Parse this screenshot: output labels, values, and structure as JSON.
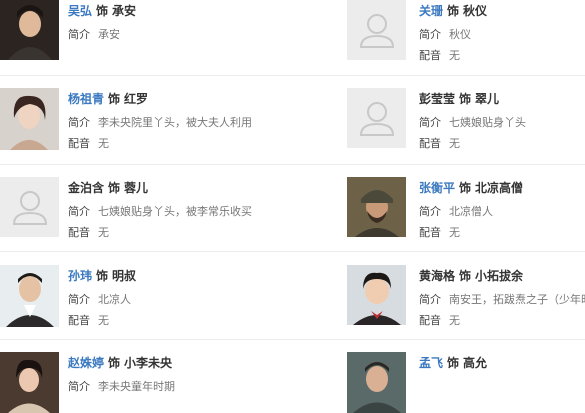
{
  "rows": [
    {
      "left": {
        "actor": "吴弘",
        "as": "饰",
        "role": "承安",
        "intro_label": "简介",
        "intro": "承安",
        "dub_label": "",
        "dub": ""
      },
      "right": {
        "actor": "关珊",
        "as": "饰",
        "role": "秋仪",
        "intro_label": "简介",
        "intro": "秋仪",
        "dub_label": "配音",
        "dub": "无"
      }
    },
    {
      "left": {
        "actor": "杨祖青",
        "as": "饰",
        "role": "红罗",
        "intro_label": "简介",
        "intro": "李未央院里丫头，被大夫人利用",
        "dub_label": "配音",
        "dub": "无"
      },
      "right": {
        "actor": "彭莹莹",
        "as": "饰",
        "role": "翠儿",
        "intro_label": "简介",
        "intro": "七姨娘贴身丫头",
        "dub_label": "配音",
        "dub": "无"
      }
    },
    {
      "left": {
        "actor": "金泊含",
        "as": "饰",
        "role": "蓉儿",
        "intro_label": "简介",
        "intro": "七姨娘贴身丫头，被李常乐收买",
        "dub_label": "配音",
        "dub": "无"
      },
      "right": {
        "actor": "张衡平",
        "as": "饰",
        "role": "北凉高僧",
        "intro_label": "简介",
        "intro": "北凉僧人",
        "dub_label": "配音",
        "dub": "无"
      }
    },
    {
      "left": {
        "actor": "孙玮",
        "as": "饰",
        "role": "明叔",
        "intro_label": "简介",
        "intro": "北凉人",
        "dub_label": "配音",
        "dub": "无"
      },
      "right": {
        "actor": "黄海格",
        "as": "饰",
        "role": "小拓拔余",
        "intro_label": "简介",
        "intro": "南安王，拓跋焘之子（少年时）",
        "dub_label": "配音",
        "dub": "无"
      }
    },
    {
      "left": {
        "actor": "赵姝婷",
        "as": "饰",
        "role": "小李未央",
        "intro_label": "简介",
        "intro": "李未央童年时期",
        "dub_label": "",
        "dub": ""
      },
      "right": {
        "actor": "孟飞",
        "as": "饰",
        "role": "高允",
        "intro_label": "",
        "intro": "",
        "dub_label": "",
        "dub": ""
      }
    }
  ],
  "colors": {
    "actor_link": "#3b79c0",
    "text": "#666666",
    "separator": "#ececec"
  },
  "icons": {
    "placeholder": "person-placeholder-icon"
  }
}
